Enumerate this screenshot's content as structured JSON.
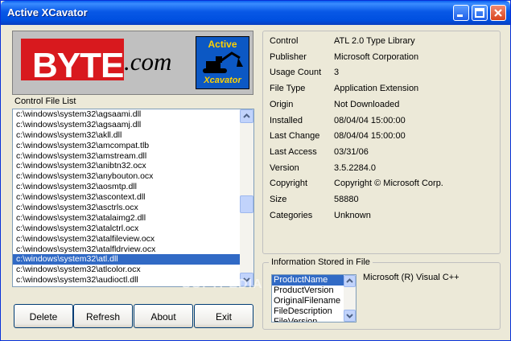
{
  "window": {
    "title": "Active XCavator"
  },
  "logo": {
    "byte": "BYTE",
    "com": ".com",
    "product_top": "Active",
    "product_bottom": "Xcavator"
  },
  "list": {
    "label": "Control File List",
    "items": [
      "c:\\windows\\system32\\agsaami.dll",
      "c:\\windows\\system32\\agsaamj.dll",
      "c:\\windows\\system32\\akll.dll",
      "c:\\windows\\system32\\amcompat.tlb",
      "c:\\windows\\system32\\amstream.dll",
      "c:\\windows\\system32\\anibtn32.ocx",
      "c:\\windows\\system32\\anybouton.ocx",
      "c:\\windows\\system32\\aosmtp.dll",
      "c:\\windows\\system32\\ascontext.dll",
      "c:\\windows\\system32\\asctrls.ocx",
      "c:\\windows\\system32\\atalaimg2.dll",
      "c:\\windows\\system32\\atalctrl.ocx",
      "c:\\windows\\system32\\atalfileview.ocx",
      "c:\\windows\\system32\\atalfldrview.ocx",
      "c:\\windows\\system32\\atl.dll",
      "c:\\windows\\system32\\atlcolor.ocx",
      "c:\\windows\\system32\\audioctl.dll"
    ],
    "selected_index": 14
  },
  "buttons": {
    "delete": "Delete",
    "refresh": "Refresh",
    "about": "About",
    "exit": "Exit"
  },
  "properties": [
    {
      "label": "Control",
      "value": "ATL 2.0 Type Library"
    },
    {
      "label": "Publisher",
      "value": "Microsoft Corporation"
    },
    {
      "label": "Usage Count",
      "value": "3"
    },
    {
      "label": "File Type",
      "value": "Application Extension"
    },
    {
      "label": "Origin",
      "value": "Not Downloaded"
    },
    {
      "label": "Installed",
      "value": "08/04/04 15:00:00"
    },
    {
      "label": "Last Change",
      "value": "08/04/04 15:00:00"
    },
    {
      "label": "Last Access",
      "value": "03/31/06"
    },
    {
      "label": "Version",
      "value": "3.5.2284.0"
    },
    {
      "label": "Copyright",
      "value": "Copyright © Microsoft Corp."
    },
    {
      "label": "Size",
      "value": "58880"
    },
    {
      "label": "Categories",
      "value": "Unknown"
    }
  ],
  "info": {
    "title": "Information Stored in File",
    "items": [
      "ProductName",
      "ProductVersion",
      "OriginalFilename",
      "FileDescription",
      "FileVersion"
    ],
    "selected_index": 0,
    "value": "Microsoft (R) Visual C++"
  },
  "watermark": "SOFTPEDIA",
  "colors": {
    "title_bar": "#0054e3",
    "selection": "#316ac5",
    "byte_red": "#d8191e",
    "logo_blue": "#0c58c4",
    "logo_yellow": "#ffd100"
  }
}
